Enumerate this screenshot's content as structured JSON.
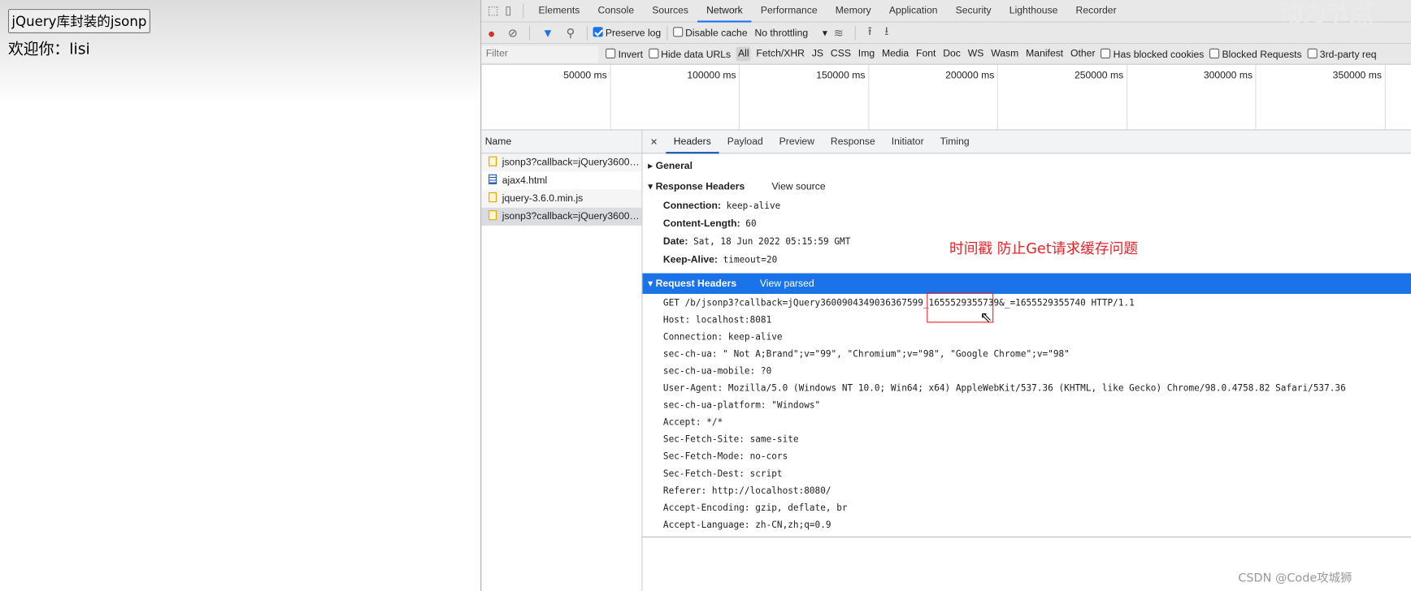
{
  "page": {
    "button": "jQuery库封装的jsonp",
    "welcome": "欢迎你：lisi"
  },
  "devtools": {
    "tabs": [
      "Elements",
      "Console",
      "Sources",
      "Network",
      "Performance",
      "Memory",
      "Application",
      "Security",
      "Lighthouse",
      "Recorder"
    ],
    "active_tab": "Network",
    "toolbar": {
      "preserve_log": "Preserve log",
      "preserve_log_checked": true,
      "disable_cache": "Disable cache",
      "disable_cache_checked": false,
      "throttling": "No throttling"
    },
    "filter": {
      "placeholder": "Filter",
      "invert": "Invert",
      "hide_data_urls": "Hide data URLs",
      "types": [
        "All",
        "Fetch/XHR",
        "JS",
        "CSS",
        "Img",
        "Media",
        "Font",
        "Doc",
        "WS",
        "Wasm",
        "Manifest",
        "Other"
      ],
      "has_blocked_cookies": "Has blocked cookies",
      "blocked_requests": "Blocked Requests",
      "third_party": "3rd-party req"
    },
    "timeline_ticks": [
      "50000 ms",
      "100000 ms",
      "150000 ms",
      "200000 ms",
      "250000 ms",
      "300000 ms",
      "350000 ms"
    ],
    "names": {
      "header": "Name",
      "rows": [
        {
          "name": "jsonp3?callback=jQuery36005...",
          "type": "script"
        },
        {
          "name": "ajax4.html",
          "type": "document"
        },
        {
          "name": "jquery-3.6.0.min.js",
          "type": "script"
        },
        {
          "name": "jsonp3?callback=jQuery36009...",
          "type": "script",
          "selected": true
        }
      ]
    },
    "detail_tabs": [
      "Headers",
      "Payload",
      "Preview",
      "Response",
      "Initiator",
      "Timing"
    ],
    "general": "General",
    "response_headers": {
      "title": "Response Headers",
      "toggle": "View source",
      "items": [
        {
          "k": "Connection:",
          "v": "keep-alive"
        },
        {
          "k": "Content-Length:",
          "v": "60"
        },
        {
          "k": "Date:",
          "v": "Sat, 18 Jun 2022 05:15:59 GMT"
        },
        {
          "k": "Keep-Alive:",
          "v": "timeout=20"
        }
      ]
    },
    "request_headers": {
      "title": "Request Headers",
      "toggle": "View parsed",
      "lines": [
        "GET /b/jsonp3?callback=jQuery36009043490363675​99_1655529355739&_=1655529355740 HTTP/1.1",
        "Host: localhost:8081",
        "Connection: keep-alive",
        "sec-ch-ua: \" Not A;Brand\";v=\"99\", \"Chromium\";v=\"98\", \"Google Chrome\";v=\"98\"",
        "sec-ch-ua-mobile: ?0",
        "User-Agent: Mozilla/5.0 (Windows NT 10.0; Win64; x64) AppleWebKit/537.36 (KHTML, like Gecko) Chrome/98.0.4758.82 Safari/537.36",
        "sec-ch-ua-platform: \"Windows\"",
        "Accept: */*",
        "Sec-Fetch-Site: same-site",
        "Sec-Fetch-Mode: no-cors",
        "Sec-Fetch-Dest: script",
        "Referer: http://localhost:8080/",
        "Accept-Encoding: gzip, deflate, br",
        "Accept-Language: zh-CN,zh;q=0.9"
      ]
    }
  },
  "annotation": "时间戳 防止Get请求缓存问题",
  "watermarks": {
    "top": "动力节点",
    "bottom": "CSDN @Code攻城狮"
  },
  "colors": {
    "accent": "#1a73e8",
    "annotation": "#e8232a",
    "record": "#d93025"
  }
}
